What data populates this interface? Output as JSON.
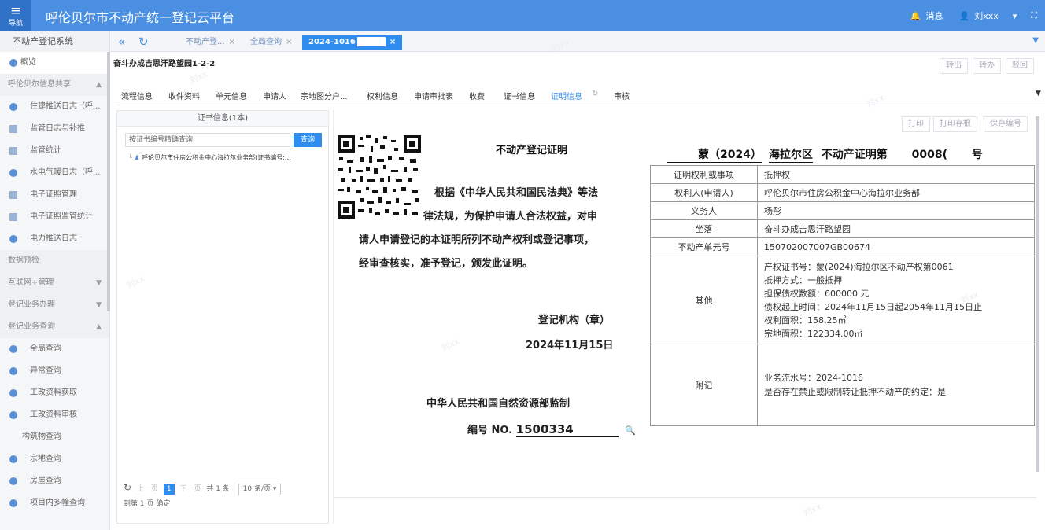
{
  "app": {
    "title": "呼伦贝尔市不动产统一登记云平台",
    "nav_label": "导航"
  },
  "topbar": {
    "bell_label": "消息",
    "user_name": "刘xxx"
  },
  "subbar": {
    "system": "不动产登记系统",
    "tabs": [
      {
        "label": "不动产登...",
        "active": false
      },
      {
        "label": "全局查询",
        "active": false
      },
      {
        "label": "2024-1016",
        "active": true
      }
    ]
  },
  "sidebar": {
    "items": [
      {
        "label": "概览",
        "kind": "top"
      },
      {
        "label": "呼伦贝尔信息共享",
        "kind": "group",
        "arrow": "▲"
      },
      {
        "label": "住建推送日志（呼...",
        "kind": "sub",
        "icon": "dot"
      },
      {
        "label": "监管日志与补推",
        "kind": "sub",
        "icon": "doc"
      },
      {
        "label": "监管统计",
        "kind": "sub",
        "icon": "doc"
      },
      {
        "label": "水电气暖日志（呼...",
        "kind": "sub",
        "icon": "dot"
      },
      {
        "label": "电子证照管理",
        "kind": "sub",
        "icon": "doc"
      },
      {
        "label": "电子证照监管统计",
        "kind": "sub",
        "icon": "doc"
      },
      {
        "label": "电力推送日志",
        "kind": "sub",
        "icon": "dot"
      },
      {
        "label": "数据预检",
        "kind": "group",
        "arrow": ""
      },
      {
        "label": "互联网+管理",
        "kind": "group",
        "arrow": "▼"
      },
      {
        "label": "登记业务办理",
        "kind": "group",
        "arrow": "▼"
      },
      {
        "label": "登记业务查询",
        "kind": "group",
        "arrow": "▲"
      },
      {
        "label": "全局查询",
        "kind": "sub",
        "icon": "dot"
      },
      {
        "label": "异常查询",
        "kind": "sub",
        "icon": "dot"
      },
      {
        "label": "工改资料获取",
        "kind": "sub",
        "icon": "dot"
      },
      {
        "label": "工改资料审核",
        "kind": "sub",
        "icon": "dot"
      },
      {
        "label": "构筑物查询",
        "kind": "plain",
        "icon": ""
      },
      {
        "label": "宗地查询",
        "kind": "sub",
        "icon": "dot"
      },
      {
        "label": "房屋查询",
        "kind": "sub",
        "icon": "dot"
      },
      {
        "label": "项目内多幢查询",
        "kind": "sub",
        "icon": "dot"
      }
    ]
  },
  "page": {
    "breadcrumb": "奋斗办成吉思汗路望园1-2-2",
    "actions": [
      "转出",
      "转办",
      "驳回"
    ],
    "cert_actions": [
      "打印",
      "打印存根",
      "保存编号"
    ]
  },
  "workflow_tabs": [
    {
      "label": "流程信息",
      "active": false
    },
    {
      "label": "收件资料",
      "active": false
    },
    {
      "label": "单元信息",
      "active": false
    },
    {
      "label": "申请人",
      "active": false
    },
    {
      "label": "宗地图分户...",
      "active": false
    },
    {
      "label": "权利信息",
      "active": false
    },
    {
      "label": "申请审批表",
      "active": false
    },
    {
      "label": "收费",
      "active": false
    },
    {
      "label": "证书信息",
      "active": false
    },
    {
      "label": "证明信息",
      "active": true
    },
    {
      "label": "审核",
      "active": false
    }
  ],
  "left_panel": {
    "header": "证书信息(1本)",
    "search_placeholder": "按证书编号精确查询",
    "search_button": "查询",
    "tree_item": "呼伦贝尔市住房公积金中心海拉尔业务部(证书编号:...",
    "pager": {
      "prev": "上一页",
      "page": "1",
      "next": "下一页",
      "total": "共 1 条",
      "page_size": "10 条/页",
      "goto_label": "到第",
      "goto_value": "1",
      "page_unit": "页",
      "confirm": "确定"
    }
  },
  "certificate": {
    "title": "不动产登记证明",
    "number_parts": [
      "蒙（2024）",
      "海拉尔区",
      "不动产证明第",
      "0008(",
      "号"
    ],
    "body": [
      "根据《中华人民共和国民法典》等法",
      "律法规，为保护申请人合法权益，对申",
      "请人申请登记的本证明所列不动产权利或登记事项，",
      "经审查核实，准予登记，颁发此证明。"
    ],
    "seal": "登记机构（章）",
    "date": "2024年11月15日",
    "supervisor": "中华人民共和国自然资源部监制",
    "serial_label": "编号 NO.",
    "serial_value": "1500334",
    "rows": [
      {
        "key": "证明权利或事项",
        "value": "抵押权"
      },
      {
        "key": "权利人(申请人)",
        "value": "呼伦贝尔市住房公积金中心海拉尔业务部"
      },
      {
        "key": "义务人",
        "value": "杨彤"
      },
      {
        "key": "坐落",
        "value": "奋斗办成吉思汗路望园"
      },
      {
        "key": "不动产单元号",
        "value": "150702007007GB00674"
      }
    ],
    "other_key": "其他",
    "other_lines": [
      "产权证书号：蒙(2024)海拉尔区不动产权第0061",
      "抵押方式：一般抵押",
      "担保债权数额：600000 元",
      "债权起止时间：2024年11月15日起2054年11月15日止",
      "权利面积：158.25㎡",
      "宗地面积：122334.00㎡"
    ],
    "note_key": "附记",
    "note_lines": [
      "业务流水号：2024-1016",
      "是否存在禁止或限制转让抵押不动产的约定：是"
    ]
  },
  "watermark": "刘xx"
}
